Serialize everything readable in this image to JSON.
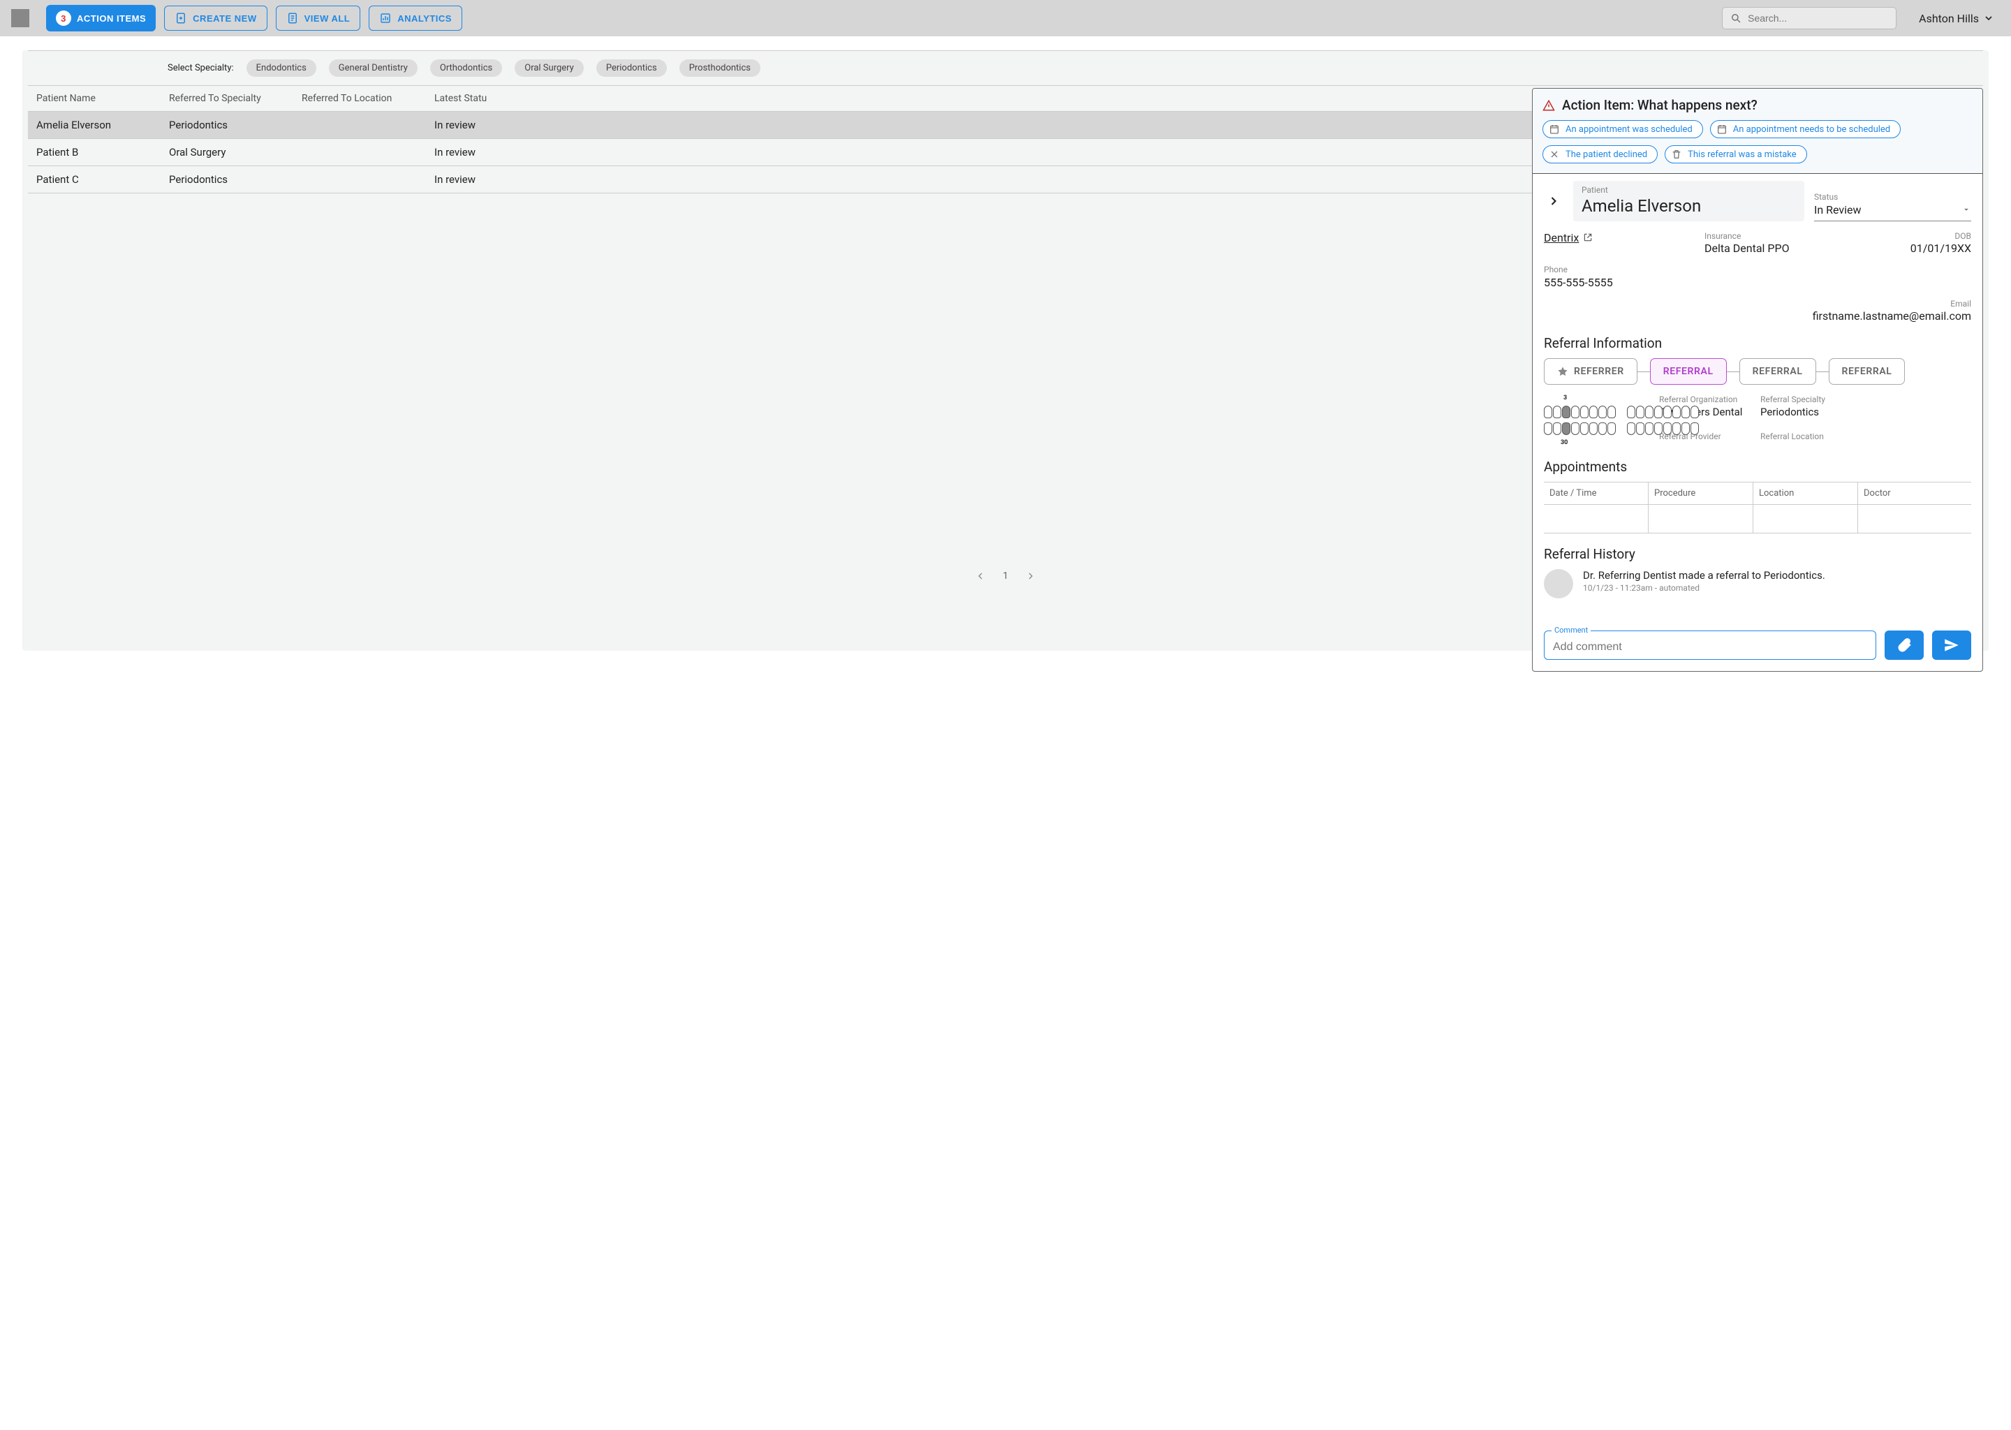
{
  "topbar": {
    "action_items_count": "3",
    "action_items_label": "ACTION ITEMS",
    "create_new_label": "CREATE NEW",
    "view_all_label": "VIEW ALL",
    "analytics_label": "ANALYTICS",
    "search_placeholder": "Search...",
    "user_name": "Ashton Hills"
  },
  "filter": {
    "label": "Select Specialty:",
    "chips": [
      "Endodontics",
      "General Dentistry",
      "Orthodontics",
      "Oral Surgery",
      "Periodontics",
      "Prosthodontics"
    ]
  },
  "table": {
    "headers": [
      "Patient Name",
      "Referred To Specialty",
      "Referred To Location",
      "Latest Statu"
    ],
    "rows": [
      {
        "name": "Amelia Elverson",
        "specialty": "Periodontics",
        "location": "",
        "status": "In review",
        "selected": true
      },
      {
        "name": "Patient B",
        "specialty": "Oral Surgery",
        "location": "",
        "status": "In review",
        "selected": false
      },
      {
        "name": "Patient C",
        "specialty": "Periodontics",
        "location": "",
        "status": "In review",
        "selected": false
      }
    ]
  },
  "pager": {
    "page": "1"
  },
  "panel": {
    "action_title": "Action Item: What happens next?",
    "pills": {
      "scheduled": "An appointment was scheduled",
      "needs_schedule": "An appointment needs to be scheduled",
      "declined": "The patient declined",
      "mistake": "This referral was a mistake"
    },
    "patient_label": "Patient",
    "patient_name": "Amelia Elverson",
    "status_label": "Status",
    "status_value": "In Review",
    "dentrix_label": "Dentrix",
    "insurance_label": "Insurance",
    "insurance_value": "Delta Dental PPO",
    "dob_label": "DOB",
    "dob_value": "01/01/19XX",
    "phone_label": "Phone",
    "phone_value": "555-555-5555",
    "email_label": "Email",
    "email_value": "firstname.lastname@email.com",
    "referral_info_title": "Referral Information",
    "flow": [
      "REFERRER",
      "REFERRAL",
      "REFERRAL",
      "REFERRAL"
    ],
    "flow_active_index": 1,
    "ref_org_label": "Referral Organization",
    "ref_org_value": "Two Rivers Dental",
    "ref_specialty_label": "Referral Specialty",
    "ref_specialty_value": "Periodontics",
    "ref_provider_label": "Referral Provider",
    "ref_location_label": "Referral Location",
    "tooth_marks": {
      "upper": "3",
      "lower": "30"
    },
    "appointments_title": "Appointments",
    "appt_headers": [
      "Date / Time",
      "Procedure",
      "Location",
      "Doctor"
    ],
    "history_title": "Referral History",
    "history_text": "Dr. Referring Dentist made a referral to Periodontics.",
    "history_meta": "10/1/23 - 11:23am - automated",
    "comment_label": "Comment",
    "comment_placeholder": "Add comment"
  }
}
